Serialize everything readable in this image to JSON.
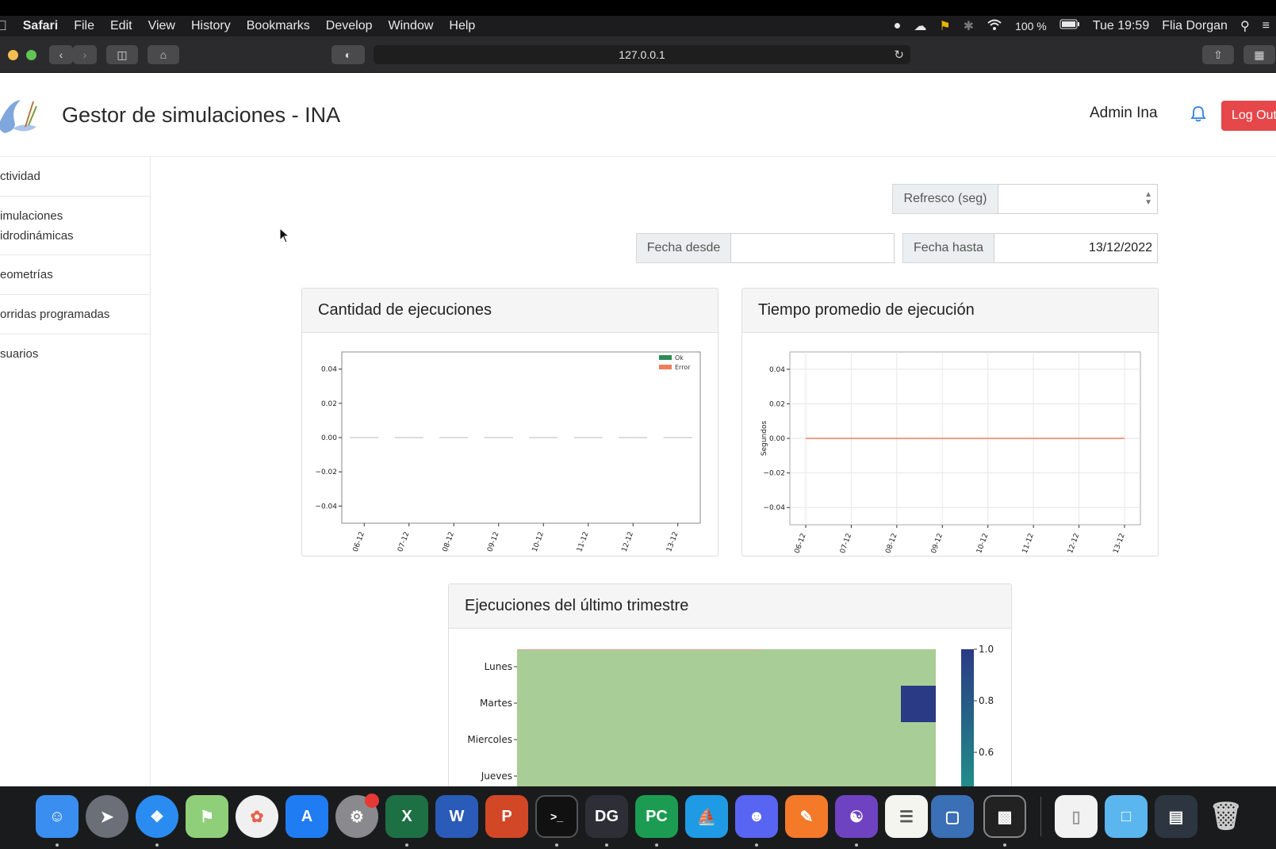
{
  "menubar": {
    "app": "Safari",
    "items": [
      "File",
      "Edit",
      "View",
      "History",
      "Bookmarks",
      "Develop",
      "Window",
      "Help"
    ],
    "battery": "100 %",
    "clock": "Tue 19:59",
    "user": "Flia Dorgan"
  },
  "browser": {
    "url": "127.0.0.1"
  },
  "app": {
    "title": "Gestor de simulaciones - INA",
    "user_name": "Admin Ina",
    "logout_label": "Log Out"
  },
  "sidebar": {
    "items": [
      {
        "line1": "ctividad",
        "line2": ""
      },
      {
        "line1": "imulaciones",
        "line2": "idrodinámicas"
      },
      {
        "line1": "eometrías",
        "line2": ""
      },
      {
        "line1": "orridas programadas",
        "line2": ""
      },
      {
        "line1": "suarios",
        "line2": ""
      }
    ]
  },
  "filters": {
    "refresh_label": "Refresco (seg)",
    "refresh_value": "",
    "date_from_label": "Fecha desde",
    "date_from_value": "",
    "date_to_label": "Fecha hasta",
    "date_to_value": "13/12/2022"
  },
  "cards": {
    "executions_title": "Cantidad de ejecuciones",
    "avg_time_title": "Tiempo promedio de ejecución",
    "quarter_title": "Ejecuciones del último trimestre"
  },
  "chart_data": [
    {
      "type": "bar",
      "title": "",
      "categories": [
        "06-12",
        "07-12",
        "08-12",
        "09-12",
        "10-12",
        "11-12",
        "12-12",
        "13-12"
      ],
      "series": [
        {
          "name": "Ok",
          "values": [
            0,
            0,
            0,
            0,
            0,
            0,
            0,
            0
          ],
          "color": "#2e8b57"
        },
        {
          "name": "Error",
          "values": [
            0,
            0,
            0,
            0,
            0,
            0,
            0,
            0
          ],
          "color": "#ee7f5c"
        }
      ],
      "yticks": [
        "0.04",
        "0.02",
        "0.00",
        "−0.02",
        "−0.04"
      ],
      "ylim": [
        -0.05,
        0.05
      ],
      "legend": "top-right",
      "xlabel": "",
      "ylabel": ""
    },
    {
      "type": "line",
      "title": "",
      "x": [
        "06-12",
        "07-12",
        "08-12",
        "09-12",
        "10-12",
        "11-12",
        "12-12",
        "13-12"
      ],
      "series": [
        {
          "values": [
            0,
            0,
            0,
            0,
            0,
            0,
            0,
            0
          ],
          "color": "#ee7f5c"
        }
      ],
      "yticks": [
        "0.04",
        "0.02",
        "0.00",
        "−0.02",
        "−0.04"
      ],
      "ylim": [
        -0.05,
        0.05
      ],
      "ylabel": "Segundos",
      "xlabel": "",
      "grid": true
    },
    {
      "type": "heatmap",
      "title": "",
      "rows": [
        "Lunes",
        "Martes",
        "Miercoles",
        "Jueves"
      ],
      "highlight": {
        "row": "Martes",
        "position": "last",
        "value": 1.0
      },
      "background_value": 0.0,
      "colorbar_ticks": [
        "1.0",
        "0.8",
        "0.6"
      ],
      "colors": {
        "low": "#a9cd96",
        "high": "#2b3a85"
      }
    }
  ]
}
